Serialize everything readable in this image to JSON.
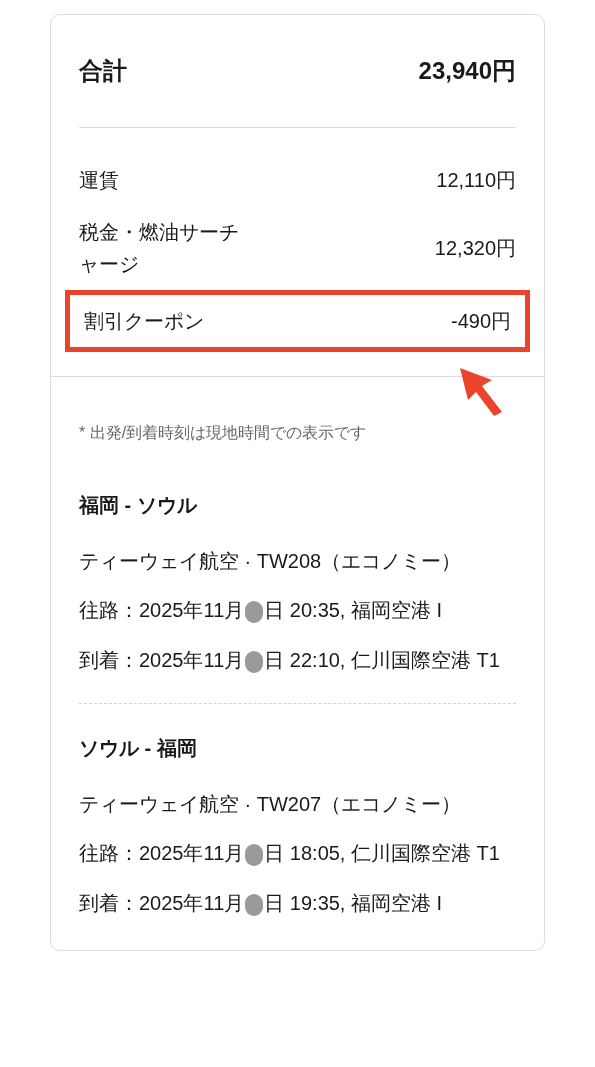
{
  "total": {
    "label": "合計",
    "amount": "23,940円"
  },
  "fares": [
    {
      "label": "運賃",
      "amount": "12,110円",
      "highlighted": false
    },
    {
      "label": "税金・燃油サーチャージ",
      "amount": "12,320円",
      "highlighted": false
    },
    {
      "label": "割引クーポン",
      "amount": "-490円",
      "highlighted": true
    }
  ],
  "note": "* 出発/到着時刻は現地時間での表示です",
  "flights": [
    {
      "route": "福岡 - ソウル",
      "carrier": "ティーウェイ航空 · TW208（エコノミー）",
      "legs": [
        {
          "before": "往路：2025年11月",
          "after": "日 20:35, 福岡空港 I"
        },
        {
          "before": "到着：2025年11月",
          "after": "日 22:10, 仁川国際空港 T1"
        }
      ]
    },
    {
      "route": "ソウル - 福岡",
      "carrier": "ティーウェイ航空 · TW207（エコノミー）",
      "legs": [
        {
          "before": "往路：2025年11月",
          "after": "日 18:05, 仁川国際空港 T1"
        },
        {
          "before": "到着：2025年11月",
          "after": "日 19:35, 福岡空港 I"
        }
      ]
    }
  ]
}
